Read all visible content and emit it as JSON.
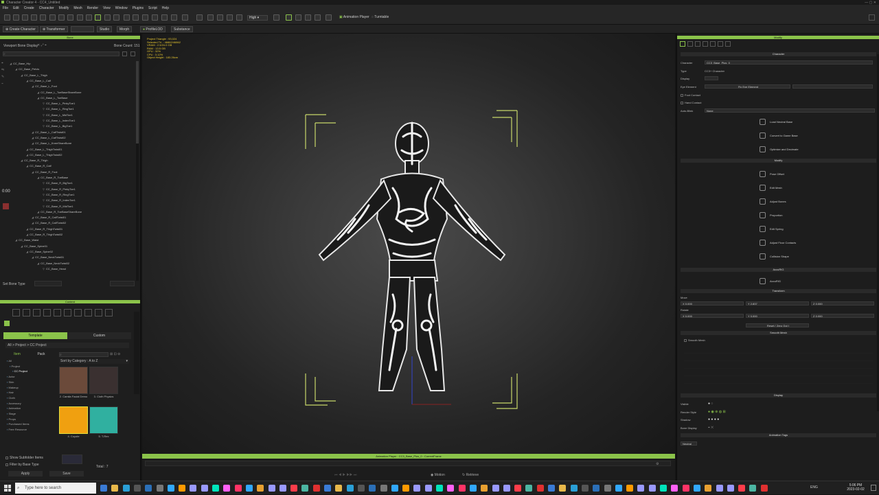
{
  "app": {
    "title": "Character Creator 4 - CC4_Untitled",
    "menu": [
      "File",
      "Edit",
      "Create",
      "Character",
      "Modify",
      "Mesh",
      "Render",
      "View",
      "Window",
      "Plugins",
      "Script",
      "Help"
    ],
    "accent": "#8bc34a"
  },
  "toolbar": {
    "quality": "High",
    "animation_player": "Animation Player",
    "turntable": "Turntable"
  },
  "toolbar2": {
    "create_character": "Create Character",
    "transformer": "Transformer",
    "studio": "Studio",
    "morph": "Morph",
    "profile_lod": "ProfileLOD",
    "substance": "Substance"
  },
  "left": {
    "header": "Bone",
    "viewport_bone_display": "Viewport Bone Display",
    "bone_count_label": "Bone Count:",
    "bone_count": "151",
    "time": "0:00",
    "set_bone_type": "Set Bone Type",
    "bones": [
      {
        "n": "CC_Base_Hip",
        "d": 0
      },
      {
        "n": "CC_Base_Pelvis",
        "d": 1
      },
      {
        "n": "CC_Base_L_Thigh",
        "d": 2
      },
      {
        "n": "CC_Base_L_Calf",
        "d": 3
      },
      {
        "n": "CC_Base_L_Foot",
        "d": 4
      },
      {
        "n": "CC_Base_L_ToeBaseShareBone",
        "d": 5
      },
      {
        "n": "CC_Base_L_ToeBase",
        "d": 5
      },
      {
        "n": "CC_Base_L_PinkyToe1",
        "d": 6
      },
      {
        "n": "CC_Base_L_RingToe1",
        "d": 6
      },
      {
        "n": "CC_Base_L_MidToe1",
        "d": 6
      },
      {
        "n": "CC_Base_L_IndexToe1",
        "d": 6
      },
      {
        "n": "CC_Base_L_BigToe1",
        "d": 6
      },
      {
        "n": "CC_Base_L_CalfTwist01",
        "d": 4
      },
      {
        "n": "CC_Base_L_CalfTwist02",
        "d": 4
      },
      {
        "n": "CC_Base_L_KneeShareBone",
        "d": 4
      },
      {
        "n": "CC_Base_L_ThighTwist01",
        "d": 3
      },
      {
        "n": "CC_Base_L_ThighTwist02",
        "d": 3
      },
      {
        "n": "CC_Base_R_Thigh",
        "d": 2
      },
      {
        "n": "CC_Base_R_Calf",
        "d": 3
      },
      {
        "n": "CC_Base_R_Foot",
        "d": 4
      },
      {
        "n": "CC_Base_R_ToeBase",
        "d": 5
      },
      {
        "n": "CC_Base_R_BigToe1",
        "d": 6
      },
      {
        "n": "CC_Base_R_PinkyToe1",
        "d": 6
      },
      {
        "n": "CC_Base_R_RingToe1",
        "d": 6
      },
      {
        "n": "CC_Base_R_IndexToe1",
        "d": 6
      },
      {
        "n": "CC_Base_R_MidToe1",
        "d": 6
      },
      {
        "n": "CC_Base_R_ToeBaseShareBone",
        "d": 5
      },
      {
        "n": "CC_Base_R_CalfTwist01",
        "d": 4
      },
      {
        "n": "CC_Base_R_CalfTwist02",
        "d": 4
      },
      {
        "n": "CC_Base_R_ThighTwist01",
        "d": 3
      },
      {
        "n": "CC_Base_R_ThighTwist02",
        "d": 3
      },
      {
        "n": "CC_Base_Waist",
        "d": 1
      },
      {
        "n": "CC_Base_Spine01",
        "d": 2
      },
      {
        "n": "CC_Base_Spine02",
        "d": 3
      },
      {
        "n": "CC_Base_NeckTwist01",
        "d": 4
      },
      {
        "n": "CC_Base_NeckTwist02",
        "d": 5
      },
      {
        "n": "CC_Base_Head",
        "d": 6
      }
    ]
  },
  "content": {
    "header": "Content",
    "tab_template": "Template",
    "tab_custom": "Custom",
    "item": "Item",
    "pack": "Pack",
    "sort": "Sort by Category : A to Z",
    "breadcrumb": "All > Project > CC Project",
    "tree": [
      "All",
      "Project",
      "CC Project",
      "Actor",
      "Skin",
      "Makeup",
      "Hair",
      "Cloth",
      "Accessory",
      "Animation",
      "Stage",
      "Props",
      "Purchased Items",
      "Free Resource"
    ],
    "items": [
      {
        "label": "2. Camila Facial Demo",
        "color": "#6b4a3a"
      },
      {
        "label": "3. Cloth Physics",
        "color": "#3a3030"
      },
      {
        "label": "4. Coyote",
        "color": "#f0a010"
      },
      {
        "label": "5. T-Rex",
        "color": "#30b0a0"
      }
    ],
    "show_subfolder": "Show Subfolder Items",
    "filter_base_type": "Filter by Base Type",
    "apply": "Apply",
    "save": "Save",
    "total": "Total : 7"
  },
  "viewport": {
    "stats": [
      "Project Triangle : 93,024",
      "Selected Tri. : 46862/46862",
      "VRAM : 2.5/24.0 GB",
      "RAM : 13.5 GB",
      "GPU : 32%",
      "CPU : 3.12%",
      "Object Height : 183.26cm"
    ]
  },
  "anim": {
    "title": "Animation Player : CC3_Base_Plus_0 : CurrentFrame",
    "motion": "Motion",
    "retrieve": "Retrieve"
  },
  "right": {
    "header": "Modify",
    "sec_character": "Character",
    "character_label": "Character",
    "character_value": "CC3_Base_Plus_0",
    "type_label": "Type",
    "type_value": "CC3+ Character",
    "display_label": "Display",
    "eye_label": "Eye Element",
    "fix_eye": "Fix Eye Element",
    "foot_contact": "Foot Contact",
    "hand_contact": "Hand Contact",
    "auto_blink": "Auto-Blink",
    "auto_blink_value": "None",
    "actions1": [
      "Load Neutral Base",
      "Convert to Game Base",
      "Optimize and Decimate"
    ],
    "sec_modify": "Modify",
    "actions2": [
      "Pose Offset",
      "Edit Mesh",
      "Adjust Bones",
      "Proportion",
      "Edit Spring",
      "Adjust Floor Contacts",
      "Collision Shape"
    ],
    "sec_accurig": "AccuRIG",
    "accurig": "AccuRIG",
    "sec_transform": "Transform",
    "move": "Move",
    "rotate": "Rotate",
    "move_x": "0.000",
    "move_y": "2.837",
    "move_z": "0.000",
    "rot_x": "0.000",
    "rot_y": "0.000",
    "rot_z": "0.000",
    "reset": "Reset ( Zero Out )",
    "sec_smooth": "Smooth Mesh",
    "smooth_mesh": "Smooth Mesh",
    "sec_display": "Display",
    "visible": "Visible",
    "render_style": "Render Style",
    "shadow": "Shadow",
    "bone_display": "Bone Display",
    "sec_anim_tags": "Animation Tags",
    "neutral": "Neutral"
  },
  "taskbar": {
    "search": "Type here to search",
    "lang": "ENG",
    "time": "5:06 PM",
    "date": "2023-02-02"
  }
}
